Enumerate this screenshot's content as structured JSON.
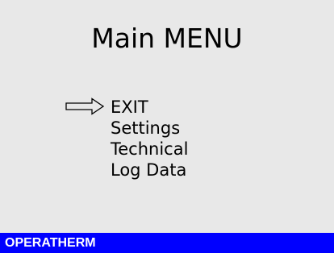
{
  "screen": {
    "title": "Main MENU",
    "background_color": "#e8e8e8"
  },
  "menu": {
    "selected_index": 0,
    "pointer_icon": "right-arrow-outline-icon",
    "items": [
      {
        "label": "EXIT"
      },
      {
        "label": "Settings"
      },
      {
        "label": "Technical"
      },
      {
        "label": "Log Data"
      }
    ]
  },
  "status_bar": {
    "brand": "OPERATHERM",
    "background_color": "#0000ff",
    "text_color": "#ffffff"
  }
}
